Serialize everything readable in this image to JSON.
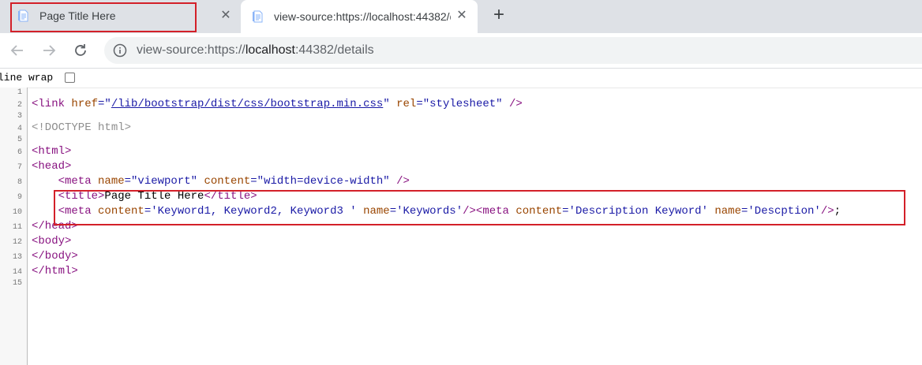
{
  "tabs": [
    {
      "title": "Page Title Here",
      "close": "✕"
    },
    {
      "title": "view-source:https://localhost:44382/details",
      "close": "✕"
    }
  ],
  "newtab_label": "+",
  "omnibox": {
    "prefix": "view-source:https://",
    "host": "localhost",
    "suffix": ":44382/details"
  },
  "line_wrap_label": "line wrap",
  "source": {
    "line_numbers": [
      "1",
      "2",
      "3",
      "4",
      "5",
      "6",
      "7",
      "8",
      "9",
      "10",
      "11",
      "12",
      "13",
      "14",
      "15"
    ],
    "l2": {
      "open": "<link ",
      "a1": "href",
      "eq": "=\"",
      "href": "/lib/bootstrap/dist/css/bootstrap.min.css",
      "q": "\" ",
      "a2": "rel",
      "v2": "=\"stylesheet\"",
      "close": " />"
    },
    "l4": "<!DOCTYPE html>",
    "l6": "<html>",
    "l7": "<head>",
    "l8": {
      "open": "    <meta ",
      "a1": "name",
      "v1": "=\"viewport\"",
      "a2": " content",
      "v2": "=\"width=device-width\"",
      "close": " />"
    },
    "l9": {
      "open": "    <title>",
      "text": "Page Title Here",
      "close": "</title>"
    },
    "l10": {
      "open": "    <meta ",
      "a1": "content",
      "v1": "='Keyword1, Keyword2, Keyword3 ' ",
      "a2": "name",
      "v2": "='Keywords'",
      "close1": "/><meta ",
      "a3": "content",
      "v3": "='Description Keyword' ",
      "a4": "name",
      "v4": "='Descption'",
      "close2": "/>",
      "text": ";"
    },
    "l11": "</head>",
    "l12": "<body>",
    "l13": "</body>",
    "l14": "</html>"
  }
}
